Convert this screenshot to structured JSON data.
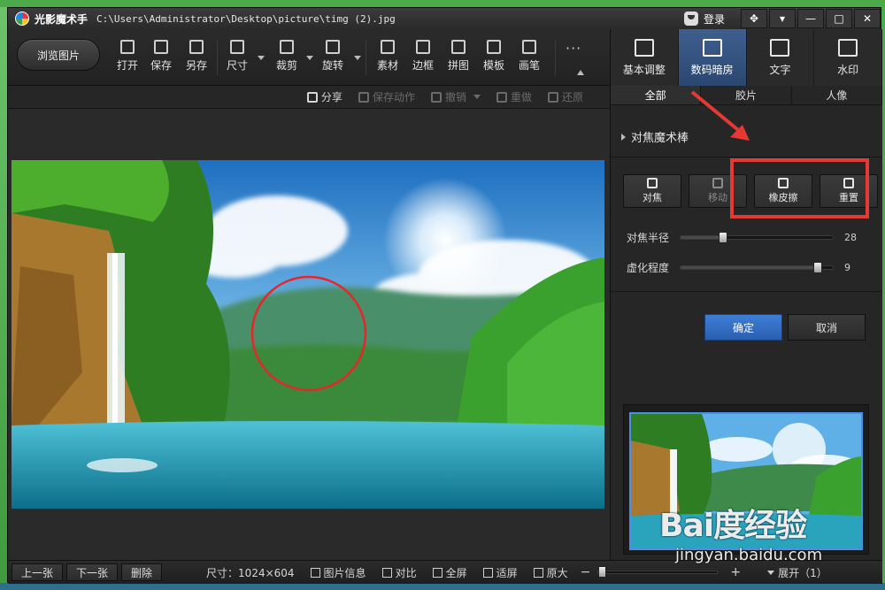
{
  "titlebar": {
    "app_name": "光影魔术手",
    "file_path": "C:\\Users\\Administrator\\Desktop\\picture\\timg (2).jpg",
    "login_label": "登录"
  },
  "toolbar": {
    "browse_label": "浏览图片",
    "tools": [
      "打开",
      "保存",
      "另存",
      "尺寸",
      "裁剪",
      "旋转",
      "素材",
      "边框",
      "拼图",
      "模板",
      "画笔"
    ],
    "more": "···"
  },
  "right_tabs": [
    "基本调整",
    "数码暗房",
    "文字",
    "水印"
  ],
  "actions": {
    "share": "分享",
    "save_action": "保存动作",
    "undo": "撤销",
    "redo": "重做",
    "restore": "还原"
  },
  "panel": {
    "subtabs": [
      "全部",
      "胶片",
      "人像"
    ],
    "section_title": "对焦魔术棒",
    "tool_buttons": [
      "对焦",
      "移动",
      "橡皮擦",
      "重置"
    ],
    "sliders": [
      {
        "label": "对焦半径",
        "value": "28",
        "fraction": 0.28
      },
      {
        "label": "虚化程度",
        "value": "9",
        "fraction": 0.9
      }
    ],
    "ok_label": "确定",
    "cancel_label": "取消"
  },
  "statusbar": {
    "prev": "上一张",
    "next": "下一张",
    "delete": "删除",
    "size_text": "尺寸：1024×604",
    "info": "图片信息",
    "compare": "对比",
    "fullscreen": "全屏",
    "fit": "适屏",
    "original": "原大",
    "minus": "−",
    "plus": "+",
    "zoom_fraction": 0.03,
    "expand": "展开（1）"
  },
  "watermark": {
    "logo": "Bai度经验",
    "url": "jingyan.baidu.com"
  },
  "colors": {
    "accent": "#2f6fc4",
    "highlight": "#e53935",
    "thumb_border": "#4a8ee8"
  }
}
